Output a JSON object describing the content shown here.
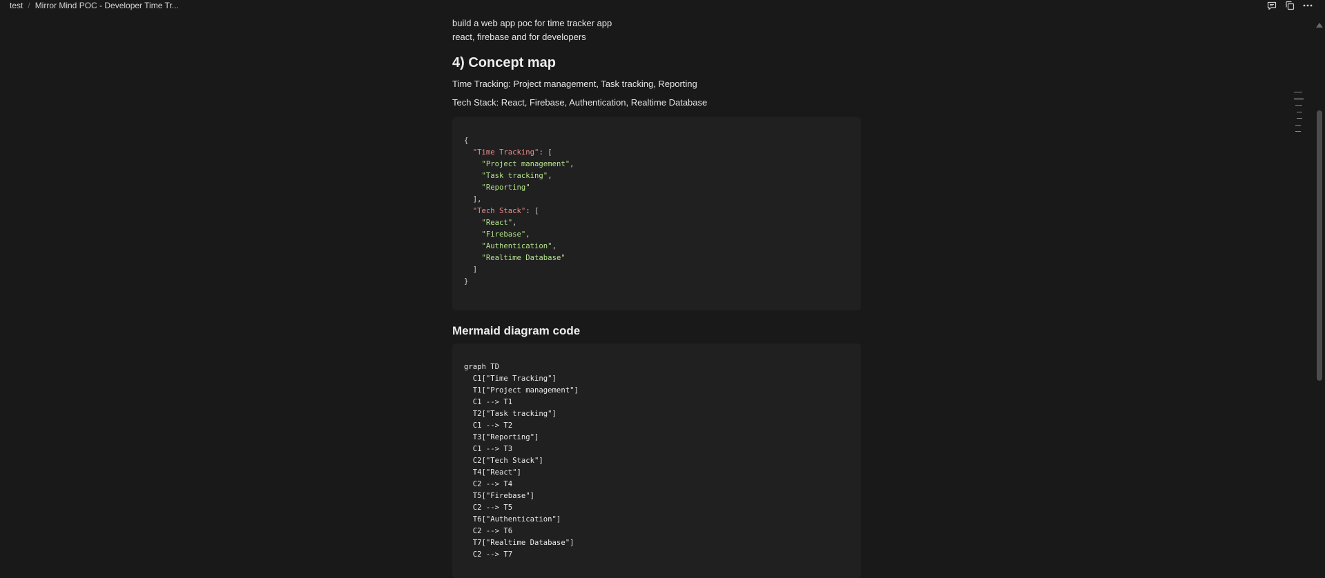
{
  "breadcrumb": {
    "workspace": "test",
    "separator": "/",
    "page": "Mirror Mind POC - Developer Time Tr..."
  },
  "top_actions": [
    {
      "icon": "comment-icon"
    },
    {
      "icon": "duplicate-icon"
    },
    {
      "icon": "more-options-icon"
    }
  ],
  "intro": {
    "line1": "build a web app poc for time tracker app",
    "line2": "react, firebase and for developers"
  },
  "concept_map": {
    "heading": "4) Concept map",
    "time_tracking_line": "Time Tracking: Project management, Task tracking, Reporting",
    "tech_stack_line": "Tech Stack: React, Firebase, Authentication, Realtime Database",
    "json_lines": [
      {
        "indent": "",
        "parts": [
          {
            "t": "punc",
            "v": "{"
          }
        ]
      },
      {
        "indent": "  ",
        "parts": [
          {
            "t": "key",
            "v": "\"Time Tracking\""
          },
          {
            "t": "punc",
            "v": ": ["
          }
        ]
      },
      {
        "indent": "    ",
        "parts": [
          {
            "t": "str",
            "v": "\"Project management\""
          },
          {
            "t": "punc",
            "v": ","
          }
        ]
      },
      {
        "indent": "    ",
        "parts": [
          {
            "t": "str",
            "v": "\"Task tracking\""
          },
          {
            "t": "punc",
            "v": ","
          }
        ]
      },
      {
        "indent": "    ",
        "parts": [
          {
            "t": "str",
            "v": "\"Reporting\""
          }
        ]
      },
      {
        "indent": "  ",
        "parts": [
          {
            "t": "punc",
            "v": "],"
          }
        ]
      },
      {
        "indent": "  ",
        "parts": [
          {
            "t": "key",
            "v": "\"Tech Stack\""
          },
          {
            "t": "punc",
            "v": ": ["
          }
        ]
      },
      {
        "indent": "    ",
        "parts": [
          {
            "t": "str",
            "v": "\"React\""
          },
          {
            "t": "punc",
            "v": ","
          }
        ]
      },
      {
        "indent": "    ",
        "parts": [
          {
            "t": "str",
            "v": "\"Firebase\""
          },
          {
            "t": "punc",
            "v": ","
          }
        ]
      },
      {
        "indent": "    ",
        "parts": [
          {
            "t": "str",
            "v": "\"Authentication\""
          },
          {
            "t": "punc",
            "v": ","
          }
        ]
      },
      {
        "indent": "    ",
        "parts": [
          {
            "t": "str",
            "v": "\"Realtime Database\""
          }
        ]
      },
      {
        "indent": "  ",
        "parts": [
          {
            "t": "punc",
            "v": "]"
          }
        ]
      },
      {
        "indent": "",
        "parts": [
          {
            "t": "punc",
            "v": "}"
          }
        ]
      }
    ]
  },
  "mermaid": {
    "heading": "Mermaid diagram code",
    "lines": [
      "graph TD",
      "  C1[\"Time Tracking\"]",
      "  T1[\"Project management\"]",
      "  C1 --> T1",
      "  T2[\"Task tracking\"]",
      "  C1 --> T2",
      "  T3[\"Reporting\"]",
      "  C1 --> T3",
      "  C2[\"Tech Stack\"]",
      "  T4[\"React\"]",
      "  C2 --> T4",
      "  T5[\"Firebase\"]",
      "  C2 --> T5",
      "  T6[\"Authentication\"]",
      "  C2 --> T6",
      "  T7[\"Realtime Database\"]",
      "  C2 --> T7"
    ]
  },
  "toc_ticks": [
    {
      "active": false
    },
    {
      "active": true
    },
    {
      "active": false
    },
    {
      "active": false
    },
    {
      "active": false
    },
    {
      "active": false
    },
    {
      "active": false
    }
  ],
  "colors": {
    "background": "#191919",
    "code_background": "#202020",
    "json_key": "#ec8c8c",
    "json_string": "#b5e48c"
  }
}
